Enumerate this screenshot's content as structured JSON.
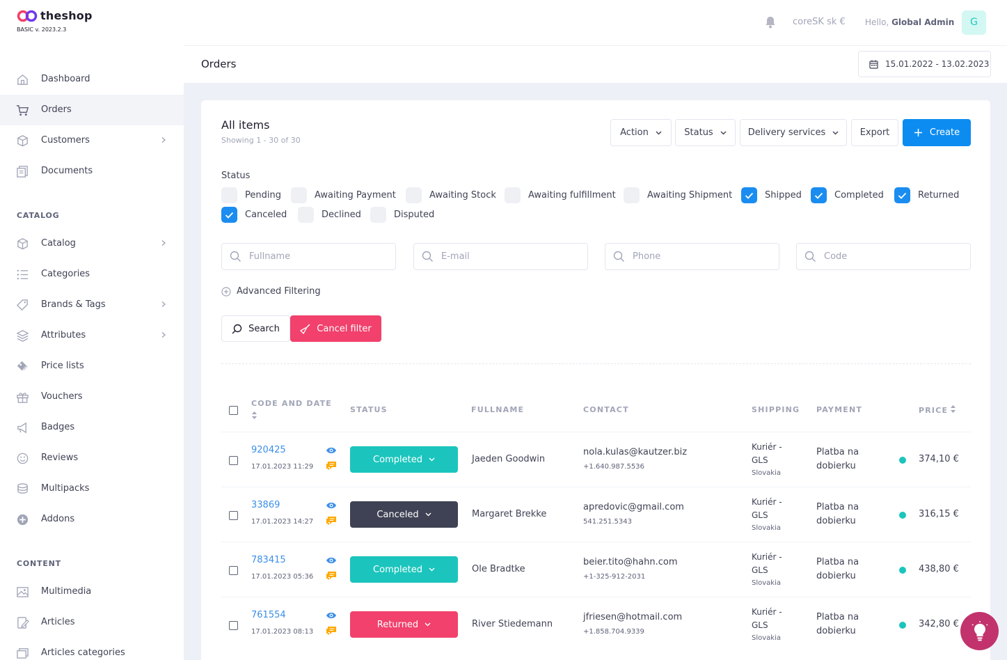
{
  "brand": {
    "name": "theshop",
    "version": "BASIC v. 2023.2.3"
  },
  "sidebar": {
    "items": [
      {
        "label": "Dashboard",
        "icon": "home-icon"
      },
      {
        "label": "Orders",
        "icon": "cart-icon",
        "active": true
      },
      {
        "label": "Customers",
        "icon": "box-icon",
        "chevron": true
      },
      {
        "label": "Documents",
        "icon": "documents-icon"
      }
    ],
    "catalog_title": "CATALOG",
    "catalog_items": [
      {
        "label": "Catalog",
        "icon": "box-icon",
        "chevron": true
      },
      {
        "label": "Categories",
        "icon": "list-icon"
      },
      {
        "label": "Brands & Tags",
        "icon": "tag-icon",
        "chevron": true
      },
      {
        "label": "Attributes",
        "icon": "layers-icon",
        "chevron": true
      },
      {
        "label": "Price lists",
        "icon": "price-icon"
      },
      {
        "label": "Vouchers",
        "icon": "gift-icon"
      },
      {
        "label": "Badges",
        "icon": "megaphone-icon"
      },
      {
        "label": "Reviews",
        "icon": "smile-icon"
      },
      {
        "label": "Multipacks",
        "icon": "stack-icon"
      },
      {
        "label": "Addons",
        "icon": "plus-circle-icon"
      }
    ],
    "content_title": "CONTENT",
    "content_items": [
      {
        "label": "Multimedia",
        "icon": "image-icon"
      },
      {
        "label": "Articles",
        "icon": "article-icon"
      },
      {
        "label": "Articles categories",
        "icon": "folders-icon"
      }
    ]
  },
  "topbar": {
    "store": "coreSK  sk  €",
    "hello_prefix": "Hello,",
    "user": "Global Admin",
    "avatar": "G"
  },
  "page": {
    "title": "Orders",
    "date_range": "15.01.2022 - 13.02.2023"
  },
  "card": {
    "title": "All items",
    "subtitle": "Showing 1 - 30 of 30",
    "toolbar": {
      "action": "Action",
      "status": "Status",
      "delivery": "Delivery services",
      "export": "Export",
      "create": "Create"
    }
  },
  "filters": {
    "status_label": "Status",
    "statuses": [
      {
        "label": "Pending",
        "checked": false
      },
      {
        "label": "Awaiting Payment",
        "checked": false
      },
      {
        "label": "Awaiting Stock",
        "checked": false
      },
      {
        "label": "Awaiting fulfillment",
        "checked": false
      },
      {
        "label": "Awaiting Shipment",
        "checked": false
      },
      {
        "label": "Shipped",
        "checked": true
      },
      {
        "label": "Completed",
        "checked": true
      },
      {
        "label": "Returned",
        "checked": true
      },
      {
        "label": "Canceled",
        "checked": true
      },
      {
        "label": "Declined",
        "checked": false
      },
      {
        "label": "Disputed",
        "checked": false
      }
    ],
    "placeholders": {
      "fullname": "Fullname",
      "email": "E-mail",
      "phone": "Phone",
      "code": "Code"
    },
    "advanced": "Advanced Filtering",
    "search": "Search",
    "cancel": "Cancel filter"
  },
  "table": {
    "headers": {
      "code_date": "CODE AND DATE",
      "status": "STATUS",
      "fullname": "FULLNAME",
      "contact": "CONTACT",
      "shipping": "SHIPPING",
      "payment": "PAYMENT",
      "price": "PRICE"
    },
    "rows": [
      {
        "code": "920425",
        "date": "17.01.2023 11:29",
        "status": "Completed",
        "status_color": "#1bc5bd",
        "name": "Jaeden Goodwin",
        "email": "nola.kulas@kautzer.biz",
        "phone": "+1.640.987.5536",
        "ship_a": "Kuriér -",
        "ship_b": "GLS",
        "ship_country": "Slovakia",
        "payment": "Platba na dobierku",
        "price": "374,10 €"
      },
      {
        "code": "33869",
        "date": "17.01.2023 14:27",
        "status": "Canceled",
        "status_color": "#3f4254",
        "name": "Margaret Brekke",
        "email": "apredovic@gmail.com",
        "phone": "541.251.5343",
        "ship_a": "Kuriér -",
        "ship_b": "GLS",
        "ship_country": "Slovakia",
        "payment": "Platba na dobierku",
        "price": "316,15 €"
      },
      {
        "code": "783415",
        "date": "17.01.2023 05:36",
        "status": "Completed",
        "status_color": "#1bc5bd",
        "name": "Ole Bradtke",
        "email": "beier.tito@hahn.com",
        "phone": "+1-325-912-2031",
        "ship_a": "Kuriér -",
        "ship_b": "GLS",
        "ship_country": "Slovakia",
        "payment": "Platba na dobierku",
        "price": "438,80 €"
      },
      {
        "code": "761554",
        "date": "17.01.2023 08:13",
        "status": "Returned",
        "status_color": "#f1416c",
        "name": "River Stiedemann",
        "email": "jfriesen@hotmail.com",
        "phone": "+1.858.704.9339",
        "ship_a": "Kuriér -",
        "ship_b": "GLS",
        "ship_country": "Slovakia",
        "payment": "Platba na dobierku",
        "price": "342,80 €"
      }
    ]
  }
}
